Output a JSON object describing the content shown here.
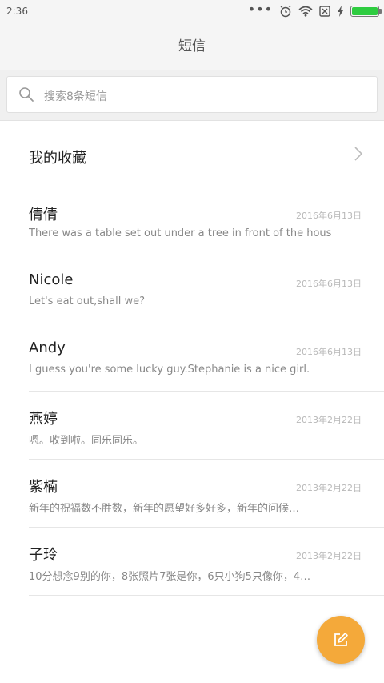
{
  "status_bar": {
    "time": "2:36",
    "icons": [
      "more-dots-icon",
      "alarm-clock-icon",
      "wifi-icon",
      "no-sim-icon",
      "charging-bolt-icon",
      "battery-icon"
    ],
    "battery_level": 1.0,
    "battery_color": "#2ecc40"
  },
  "header": {
    "title": "短信"
  },
  "search": {
    "placeholder": "搜索8条短信"
  },
  "favorites": {
    "label": "我的收藏"
  },
  "messages": [
    {
      "name": "倩倩",
      "date": "2016年6月13日",
      "preview": "There was a table set out under a tree in front of the hous"
    },
    {
      "name": "Nicole",
      "date": "2016年6月13日",
      "preview": "Let's eat out,shall we?"
    },
    {
      "name": "Andy",
      "date": "2016年6月13日",
      "preview": "I guess you're some lucky guy.Stephanie is a nice girl."
    },
    {
      "name": "燕婷",
      "date": "2013年2月22日",
      "preview": "嗯。收到啦。同乐同乐。"
    },
    {
      "name": "紫楠",
      "date": "2013年2月22日",
      "preview": "新年的祝福数不胜数，新年的愿望好多好多，新年的问候…"
    },
    {
      "name": "子玲",
      "date": "2013年2月22日",
      "preview": "10分想念9别的你，8张照片7张是你，6只小狗5只像你，4…"
    }
  ],
  "fab": {
    "icon": "compose-icon",
    "color": "#f4a93a"
  }
}
